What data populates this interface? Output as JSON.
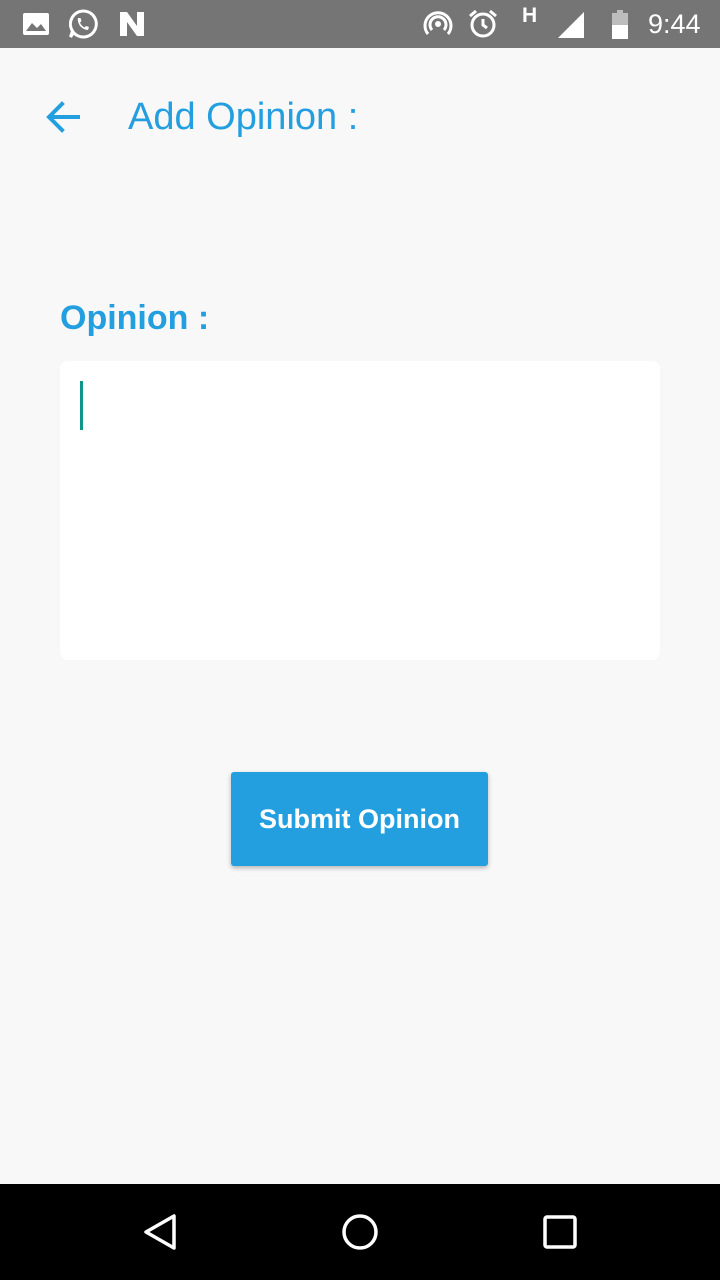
{
  "status_bar": {
    "time": "9:44",
    "network_type": "H",
    "left_icons": [
      "image-icon",
      "whatsapp-icon",
      "n-notification-icon"
    ],
    "right_icons": [
      "hotspot-icon",
      "alarm-icon",
      "network-type-icon",
      "cell-signal-icon",
      "battery-icon"
    ]
  },
  "header": {
    "title": "Add Opinion :",
    "back_icon": "arrow-left-icon"
  },
  "form": {
    "label": "Opinion :",
    "opinion_value": "",
    "opinion_placeholder": "",
    "submit_label": "Submit Opinion"
  },
  "nav_bar": {
    "buttons": [
      "back-triangle-icon",
      "home-circle-icon",
      "recents-square-icon"
    ]
  },
  "colors": {
    "accent": "#239fe0",
    "background": "#f8f8f8",
    "status_bar": "#757575",
    "caret": "#0f9488",
    "nav_bar": "#000000"
  }
}
